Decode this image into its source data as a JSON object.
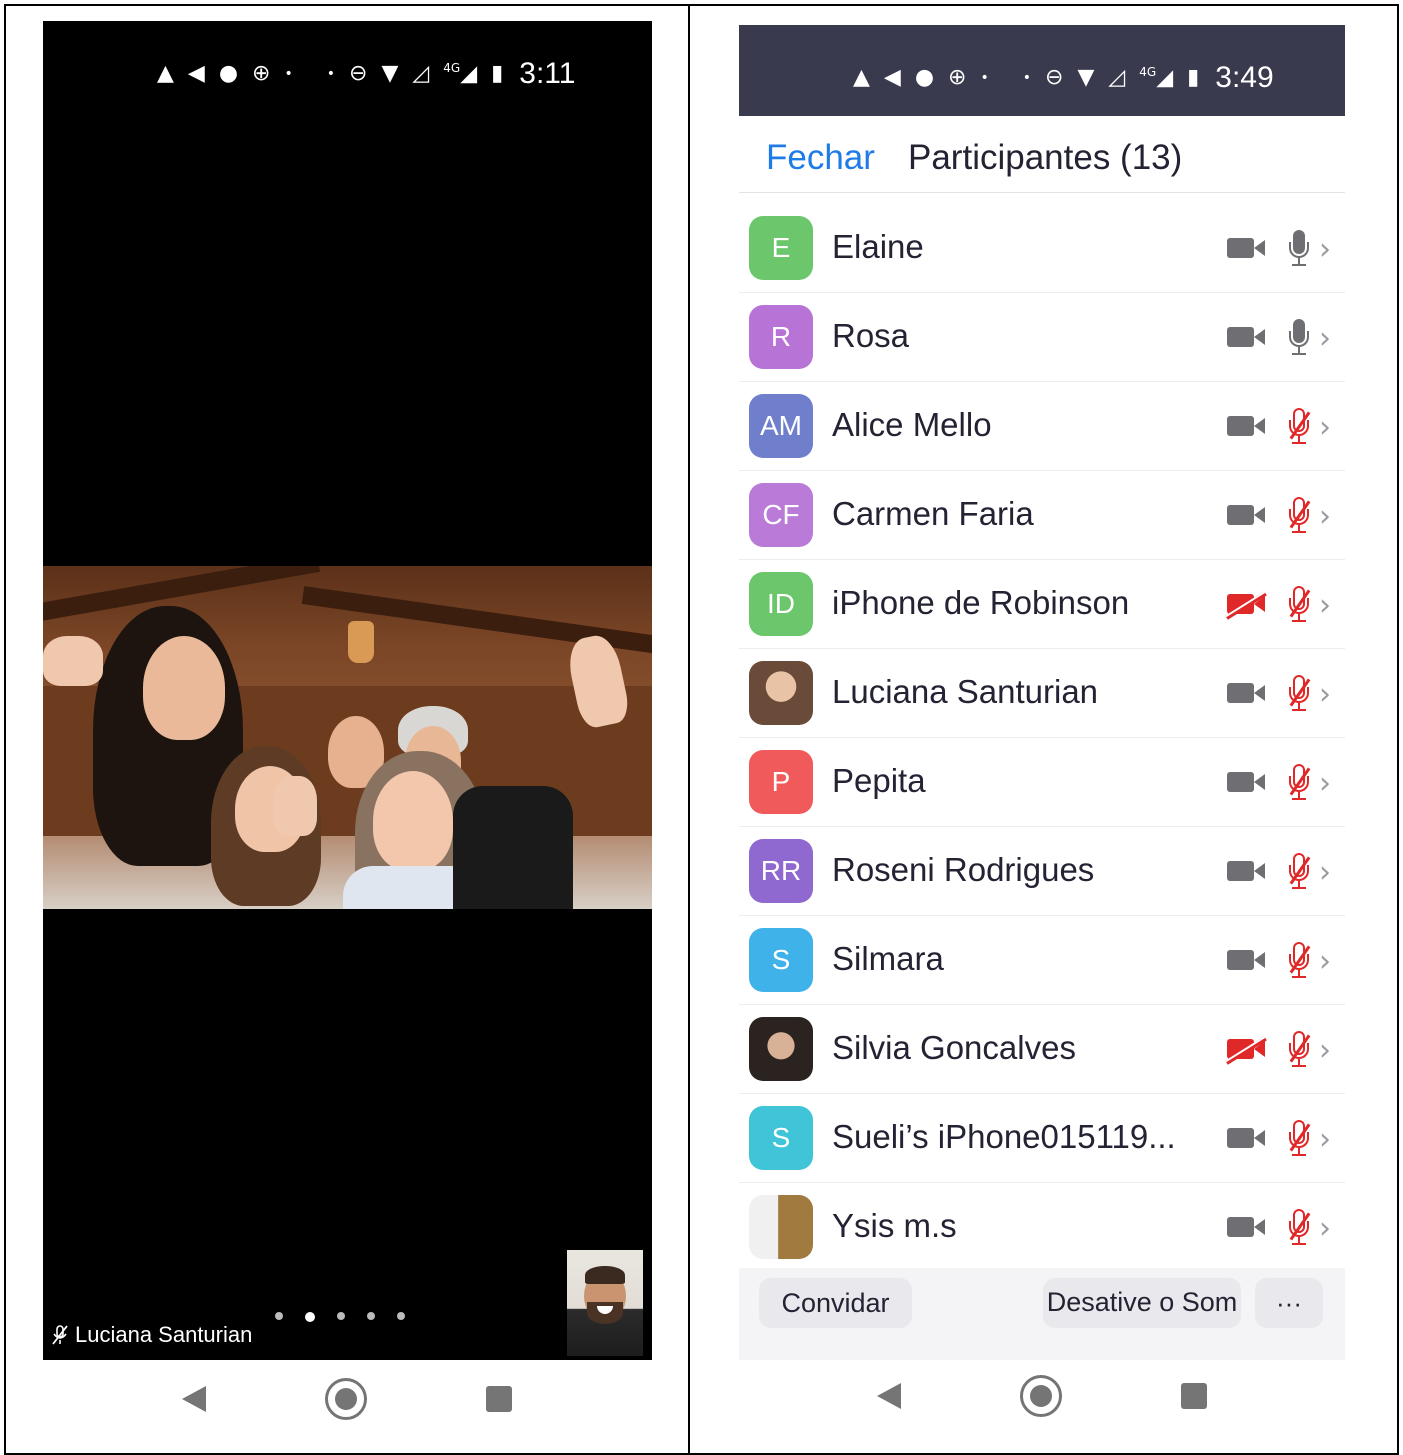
{
  "left_phone": {
    "status_time": "3:11",
    "status_icons": [
      "alert-icon",
      "telegram-icon",
      "facebook-icon",
      "globe-icon",
      "dot-icon",
      "dnd-icon",
      "wifi-icon",
      "signal-icon",
      "signal-4g-icon",
      "battery-icon"
    ],
    "network_label": "4G",
    "active_speaker": "Luciana Santurian",
    "page_dots": 5,
    "active_page": 2
  },
  "right_phone": {
    "status_time": "3:49",
    "network_label": "4G",
    "close_label": "Fechar",
    "title": "Participantes (13)",
    "participants": [
      {
        "initials": "E",
        "name": "Elaine",
        "avatar_color": "#6cc66c",
        "video_on": true,
        "mic_muted": false
      },
      {
        "initials": "R",
        "name": "Rosa",
        "avatar_color": "#b873d6",
        "video_on": true,
        "mic_muted": false
      },
      {
        "initials": "AM",
        "name": "Alice Mello",
        "avatar_color": "#6f7fcc",
        "video_on": true,
        "mic_muted": true
      },
      {
        "initials": "CF",
        "name": "Carmen Faria",
        "avatar_color": "#b97ad8",
        "video_on": true,
        "mic_muted": true
      },
      {
        "initials": "ID",
        "name": "iPhone de Robinson",
        "avatar_color": "#6cc66c",
        "video_on": false,
        "mic_muted": true
      },
      {
        "initials": "",
        "name": "Luciana Santurian",
        "avatar_color": "#8a6a55",
        "video_on": true,
        "mic_muted": true,
        "photo": true
      },
      {
        "initials": "P",
        "name": "Pepita",
        "avatar_color": "#f05a5a",
        "video_on": true,
        "mic_muted": true
      },
      {
        "initials": "RR",
        "name": "Roseni Rodrigues",
        "avatar_color": "#8f68d0",
        "video_on": true,
        "mic_muted": true
      },
      {
        "initials": "S",
        "name": "Silmara",
        "avatar_color": "#3fb2ea",
        "video_on": true,
        "mic_muted": true
      },
      {
        "initials": "",
        "name": "Silvia Goncalves",
        "avatar_color": "#4b3a33",
        "video_on": false,
        "mic_muted": true,
        "photo": true
      },
      {
        "initials": "S",
        "name": "Sueli’s iPhone015119...",
        "avatar_color": "#3fc4d8",
        "video_on": true,
        "mic_muted": true
      },
      {
        "initials": "",
        "name": "Ysis m.s",
        "avatar_color": "#6b6b6b",
        "video_on": true,
        "mic_muted": true,
        "photo": true
      }
    ],
    "invite_label": "Convidar",
    "mute_all_label": "Desative o Som de todos",
    "more_label": "···"
  },
  "colors": {
    "accent": "#1f7be6",
    "muted_red": "#e02828",
    "status_bar": "#393a4d"
  }
}
